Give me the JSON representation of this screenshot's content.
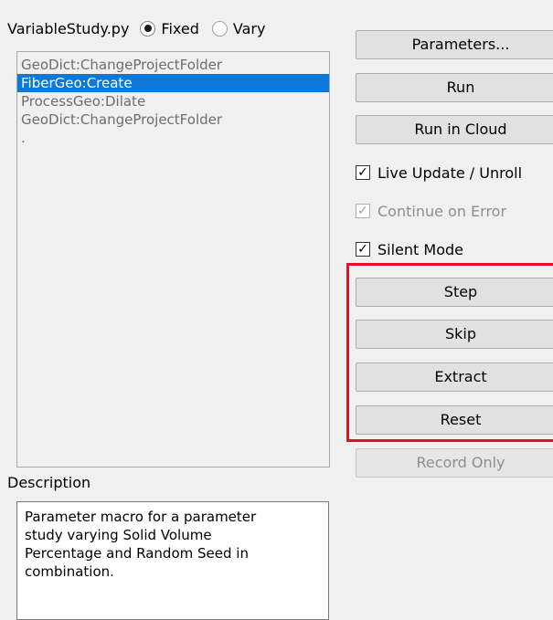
{
  "header": {
    "macro_name": "VariableStudy.py",
    "fixed_label": "Fixed",
    "vary_label": "Vary",
    "selected_mode": "Fixed"
  },
  "list": {
    "items": [
      {
        "label": "GeoDict:ChangeProjectFolder",
        "selected": false
      },
      {
        "label": "FiberGeo:Create",
        "selected": true
      },
      {
        "label": "ProcessGeo:Dilate",
        "selected": false
      },
      {
        "label": "GeoDict:ChangeProjectFolder",
        "selected": false
      },
      {
        "label": ".",
        "selected": false
      }
    ]
  },
  "description": {
    "label": "Description",
    "text_lines": [
      "Parameter macro for a parameter",
      "study varying Solid Volume",
      "Percentage and Random Seed in",
      "combination."
    ]
  },
  "buttons": {
    "parameters": "Parameters...",
    "run": "Run",
    "run_in_cloud": "Run in Cloud",
    "step": "Step",
    "skip": "Skip",
    "extract": "Extract",
    "reset": "Reset",
    "record_only": "Record Only"
  },
  "checkboxes": {
    "live_update": {
      "label": "Live Update / Unroll",
      "checked": true,
      "enabled": true
    },
    "continue_on_error": {
      "label": "Continue on Error",
      "checked": true,
      "enabled": false
    },
    "silent_mode": {
      "label": "Silent Mode",
      "checked": true,
      "enabled": true
    }
  },
  "colors": {
    "selection": "#0c78d7",
    "highlight": "#e81123",
    "window_bg": "#f0f0f0"
  }
}
